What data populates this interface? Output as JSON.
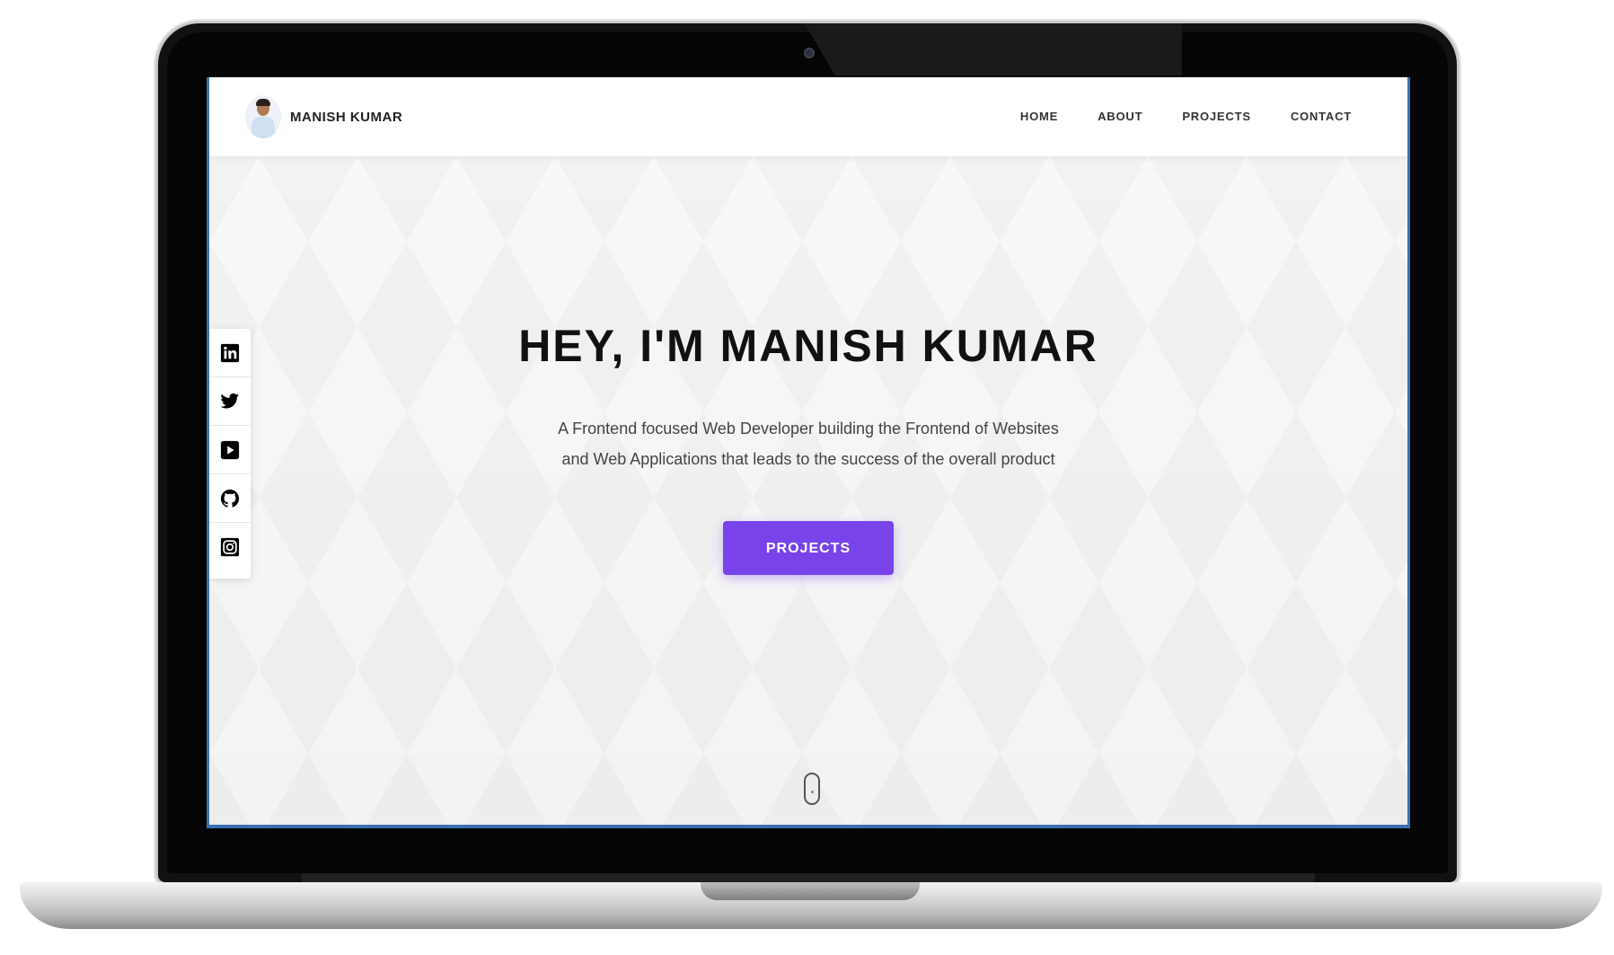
{
  "brand": {
    "name": "MANISH KUMAR"
  },
  "nav": {
    "items": [
      "HOME",
      "ABOUT",
      "PROJECTS",
      "CONTACT"
    ]
  },
  "social": {
    "icons": [
      "linkedin-icon",
      "twitter-icon",
      "youtube-icon",
      "github-icon",
      "instagram-icon"
    ]
  },
  "hero": {
    "title": "HEY, I'M MANISH KUMAR",
    "subtitle": "A Frontend focused Web Developer building the Frontend of Websites and Web Applications that leads to the success of the overall product",
    "button_label": "PROJECTS"
  },
  "colors": {
    "accent": "#7843e9",
    "screen_border": "#3a6fb0"
  }
}
